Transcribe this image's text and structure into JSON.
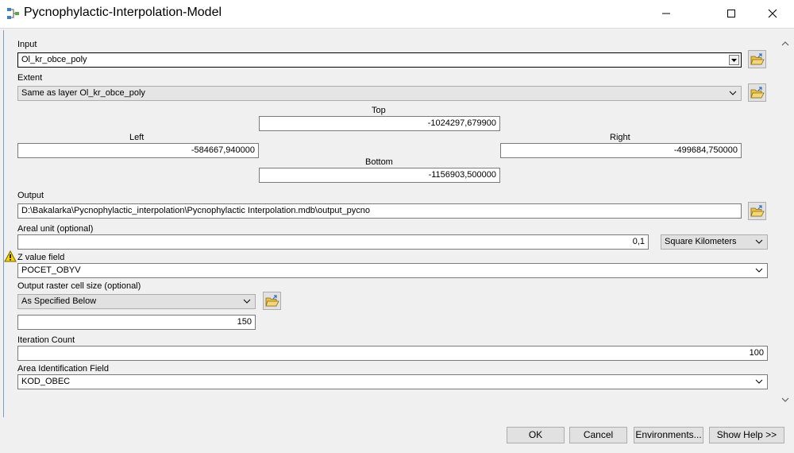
{
  "window": {
    "title": "Pycnophylactic-Interpolation-Model"
  },
  "input": {
    "label": "Input",
    "value": "Ol_kr_obce_poly"
  },
  "extent": {
    "label": "Extent",
    "value": "Same as layer Ol_kr_obce_poly",
    "top_label": "Top",
    "top_value": "-1024297,679900",
    "left_label": "Left",
    "left_value": "-584667,940000",
    "right_label": "Right",
    "right_value": "-499684,750000",
    "bottom_label": "Bottom",
    "bottom_value": "-1156903,500000"
  },
  "output": {
    "label": "Output",
    "value": "D:\\Bakalarka\\Pycnophylactic_interpolation\\Pycnophylactic Interpolation.mdb\\output_pycno"
  },
  "areal_unit": {
    "label": "Areal unit (optional)",
    "value": "0,1",
    "unit": "Square Kilometers"
  },
  "z_value": {
    "label": "Z value field",
    "value": "POCET_OBYV"
  },
  "cell_size": {
    "label": "Output raster cell size (optional)",
    "mode": "As Specified Below",
    "value": "150"
  },
  "iteration": {
    "label": "Iteration Count",
    "value": "100"
  },
  "area_id": {
    "label": "Area Identification Field",
    "value": "KOD_OBEC"
  },
  "buttons": {
    "ok": "OK",
    "cancel": "Cancel",
    "environments": "Environments...",
    "show_help": "Show Help >>"
  },
  "colors": {
    "folder": "#e8c24a",
    "warning": "#f5d100"
  }
}
